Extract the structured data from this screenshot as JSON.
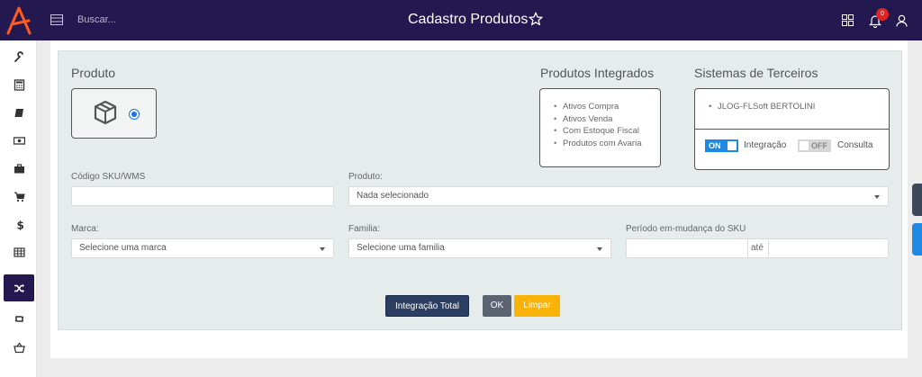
{
  "header": {
    "search_placeholder": "Buscar...",
    "title": "Cadastro Produtos",
    "notification_count": "0",
    "bg_color": "#23184f"
  },
  "sidebar": {
    "items": [
      {
        "icon": "wrench-icon"
      },
      {
        "icon": "calculator-icon"
      },
      {
        "icon": "book-icon"
      },
      {
        "icon": "money-icon"
      },
      {
        "icon": "briefcase-icon"
      },
      {
        "icon": "cart-icon"
      },
      {
        "icon": "dollar-icon"
      },
      {
        "icon": "table-icon"
      },
      {
        "icon": "shuffle-icon",
        "active": true
      },
      {
        "icon": "retweet-icon"
      },
      {
        "icon": "basket-icon"
      }
    ]
  },
  "produto_section": {
    "title": "Produto"
  },
  "integrados": {
    "title": "Produtos Integrados",
    "items": [
      "Ativos Compra",
      "Ativos Venda",
      "Com Estoque Fiscal",
      "Produtos com Avaria"
    ]
  },
  "terceiros": {
    "title": "Sistemas de Terceiros",
    "items": [
      "JLOG-FLSoft BERTOLINI"
    ],
    "toggle_on_label": "ON",
    "toggle_on_text": "Integração",
    "toggle_off_label": "OFF",
    "toggle_off_text": "Consulta"
  },
  "form": {
    "sku_label": "Código SKU/WMS",
    "sku_value": "",
    "produto_label": "Produto:",
    "produto_value": "Nada selecionado",
    "marca_label": "Marca:",
    "marca_value": "Selecione uma marca",
    "familia_label": "Familia:",
    "familia_value": "Selecione uma familia",
    "periodo_label": "Período em-mudança do SKU",
    "periodo_sep": "até"
  },
  "buttons": {
    "integracao_total": "Integração Total",
    "ok": "OK",
    "limpar": "Limpar"
  }
}
